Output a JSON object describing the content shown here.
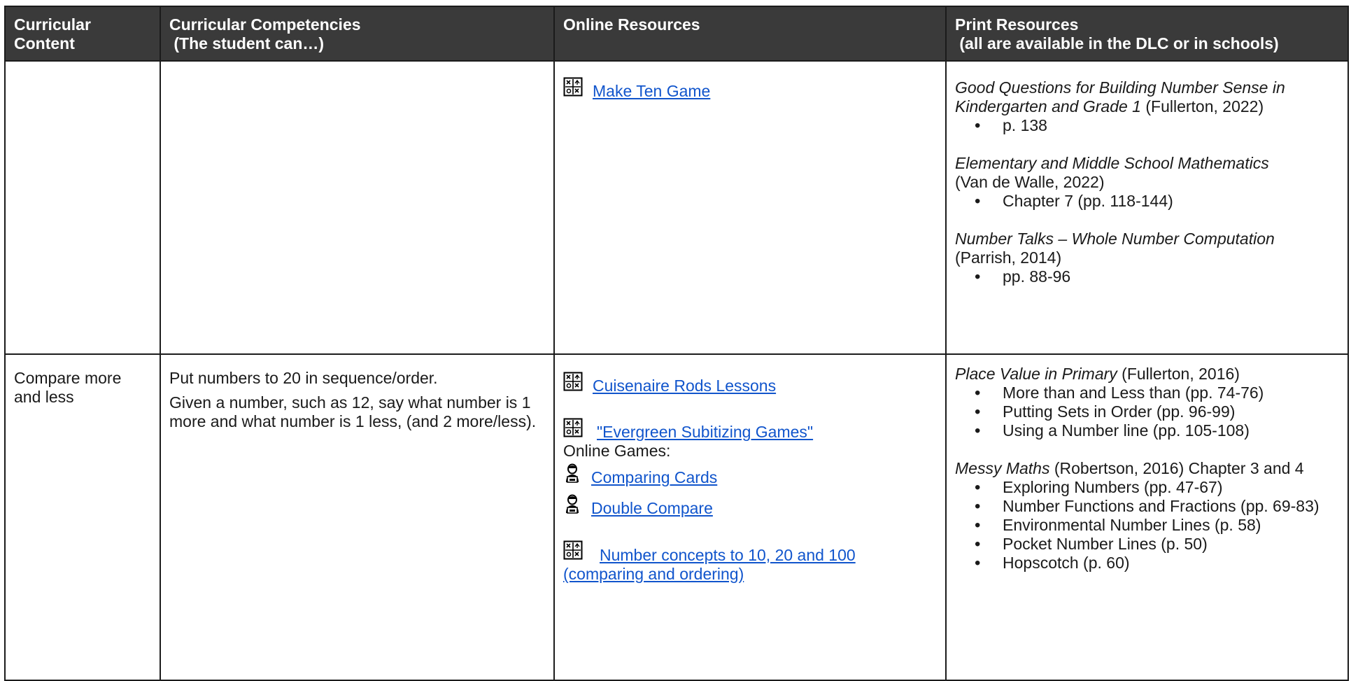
{
  "header": {
    "col1": [
      "Curricular",
      "Content"
    ],
    "col2": [
      "Curricular Competencies",
      " (The student can…)"
    ],
    "col3": "Online Resources",
    "col4": [
      "Print Resources",
      " (all are available in the DLC or in schools)"
    ]
  },
  "row1": {
    "online": {
      "make_ten": "Make Ten Game"
    },
    "print": {
      "r1_title": "Good Questions for Building Number Sense in Kindergarten and Grade 1",
      "r1_cite": " (Fullerton, 2022)",
      "r1_b1": "p. 138",
      "r2_title": "Elementary and Middle School Mathematics",
      "r2_cite": "(Van de Walle, 2022)",
      "r2_b1": "Chapter 7 (pp. 118-144)",
      "r3_title": "Number Talks – Whole Number Computation",
      "r3_cite": "(Parrish, 2014)",
      "r3_b1": "pp. 88-96"
    }
  },
  "row2": {
    "content": "Compare more and less",
    "competencies": {
      "c1": "Put numbers to 20 in sequence/order.",
      "c2": "Given a number, such as 12, say what number is 1 more and what number is 1 less, (and 2 more/less)."
    },
    "online": {
      "cuisenaire": "Cuisenaire Rods Lessons",
      "evergreen": "\"Evergreen Subitizing Games\"",
      "online_games_label": "Online Games:",
      "comparing_cards": "Comparing Cards",
      "double_compare": "Double Compare",
      "number_concepts": "Number concepts to 10, 20 and 100 (comparing and ordering)"
    },
    "print": {
      "r1_title": "Place Value in Primary",
      "r1_cite": " (Fullerton, 2016)",
      "r1_bullets": [
        "More than and Less than (pp. 74-76)",
        "Putting Sets in Order (pp. 96-99)",
        "Using a Number line (pp. 105-108)"
      ],
      "r2_title": "Messy Maths",
      "r2_cite": " (Robertson, 2016) Chapter 3 and 4",
      "r2_bullets": [
        "Exploring Numbers (pp. 47-67)",
        "Number Functions and Fractions (pp. 69-83)",
        "Environmental Number Lines (p. 58)",
        "Pocket Number Lines (p. 50)",
        "Hopscotch (p. 60)"
      ]
    }
  },
  "icons": {
    "math_resource": "math-symbols-icon",
    "online_game": "person-at-computer-icon"
  }
}
